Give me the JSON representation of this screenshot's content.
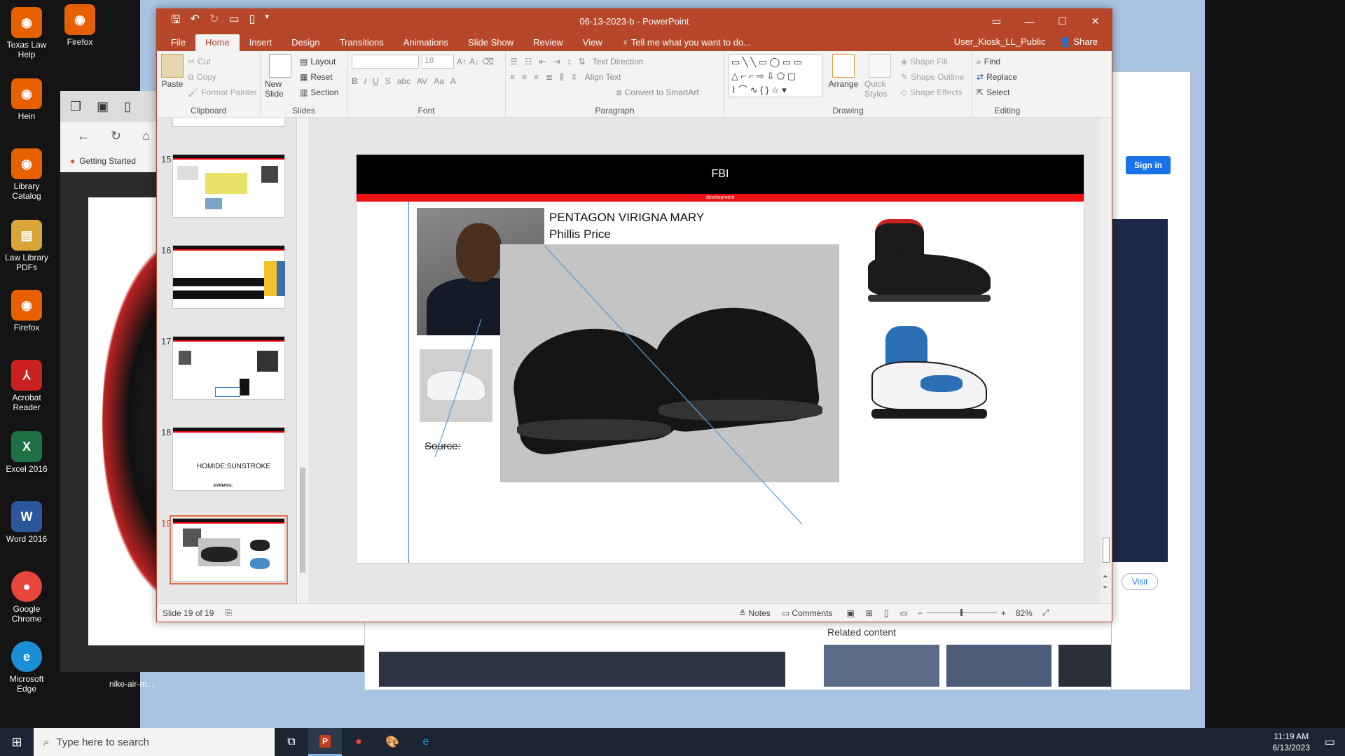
{
  "desktop": {
    "icons": [
      {
        "label": "Texas Law Help",
        "icon": "firefox-icon",
        "color": "#e66000"
      },
      {
        "label": "Firefox",
        "icon": "firefox-icon",
        "color": "#e66000"
      },
      {
        "label": "Hein",
        "icon": "firefox-icon",
        "color": "#e66000"
      },
      {
        "label": "Library Catalog",
        "icon": "firefox-icon",
        "color": "#e66000"
      },
      {
        "label": "Law Library PDFs",
        "icon": "pdf-folder-icon",
        "color": "#d9a43a"
      },
      {
        "label": "Firefox",
        "icon": "firefox-icon",
        "color": "#e66000"
      },
      {
        "label": "Acrobat Reader",
        "icon": "acrobat-icon",
        "color": "#cc1f1f"
      },
      {
        "label": "Excel 2016",
        "icon": "excel-icon",
        "color": "#1e7145"
      },
      {
        "label": "Word 2016",
        "icon": "word-icon",
        "color": "#2b579a"
      },
      {
        "label": "Google Chrome",
        "icon": "chrome-icon",
        "color": "#e8453c"
      },
      {
        "label": "Microsoft Edge",
        "icon": "edge-icon",
        "color": "#1b8fd6"
      }
    ],
    "file_label": "nike-air-m..."
  },
  "bg_browser": {
    "bookmark": "Getting Started",
    "signin": "Sign in",
    "related": "Related content",
    "visit": "Visit"
  },
  "ppt": {
    "title": "06-13-2023-b - PowerPoint",
    "tabs": [
      "File",
      "Home",
      "Insert",
      "Design",
      "Transitions",
      "Animations",
      "Slide Show",
      "Review",
      "View"
    ],
    "tell_me": "Tell me what you want to do...",
    "user": "User_Kiosk_LL_Public",
    "share": "Share",
    "ribbon": {
      "paste": "Paste",
      "cut": "Cut",
      "copy": "Copy",
      "format_painter": "Format Painter",
      "clipboard": "Clipboard",
      "new_slide": "New Slide",
      "layout": "Layout",
      "reset": "Reset",
      "section": "Section",
      "slides": "Slides",
      "font_size": "18",
      "font": "Font",
      "text_direction": "Text Direction",
      "align_text": "Align Text",
      "smartart": "Convert to SmartArt",
      "paragraph": "Paragraph",
      "arrange": "Arrange",
      "quick_styles": "Quick Styles",
      "shape_fill": "Shape Fill",
      "shape_outline": "Shape Outline",
      "shape_effects": "Shape Effects",
      "drawing": "Drawing",
      "find": "Find",
      "replace": "Replace",
      "select": "Select",
      "editing": "Editing"
    },
    "thumbnails": [
      {
        "num": "15"
      },
      {
        "num": "16"
      },
      {
        "num": "17"
      },
      {
        "num": "18",
        "text": "HOMIDE:SUNSTROKE",
        "sub": "EVIDENCE:"
      },
      {
        "num": "19"
      }
    ],
    "slide": {
      "header": "FBI",
      "banner": "development",
      "title_line1": "PENTAGON VIRIGNA MARY",
      "title_line2": "Phillis Price",
      "source": "Source:"
    },
    "status": {
      "slide_info": "Slide 19 of 19",
      "notes": "Notes",
      "comments": "Comments",
      "zoom": "82%"
    }
  },
  "taskbar": {
    "search_placeholder": "Type here to search",
    "time": "11:19 AM",
    "date": "6/13/2023"
  }
}
